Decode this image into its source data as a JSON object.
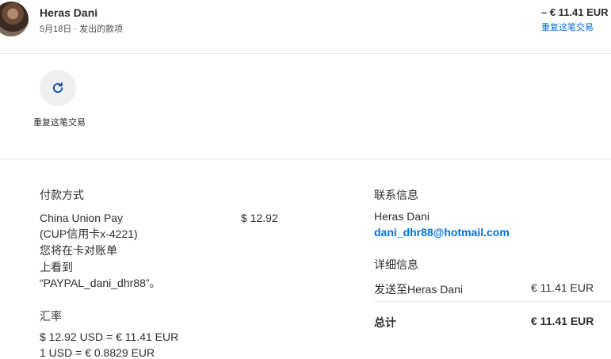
{
  "header": {
    "name": "Heras Dani",
    "subtitle": "5月18日 · 发出的款项",
    "amount": "– € 11.41 EUR",
    "repeat_link": "重复这笔交易"
  },
  "action": {
    "label": "重复这笔交易"
  },
  "payment_method": {
    "title": "付款方式",
    "lines": [
      "China Union Pay",
      "(CUP信用卡x-4221)",
      "您将在卡对账单",
      "上看到",
      "“PAYPAL_dani_dhr88”。"
    ],
    "amount": "$ 12.92"
  },
  "exchange": {
    "title": "汇率",
    "line1": "$ 12.92 USD = € 11.41 EUR",
    "line2": "1 USD = € 0.8829 EUR"
  },
  "contact": {
    "title": "联系信息",
    "name": "Heras Dani",
    "email": "dani_dhr88@hotmail.com"
  },
  "details": {
    "title": "详细信息",
    "sent_to_label": "发送至Heras Dani",
    "sent_to_amount": "€ 11.41 EUR",
    "total_label": "总计",
    "total_amount": "€ 11.41 EUR"
  }
}
